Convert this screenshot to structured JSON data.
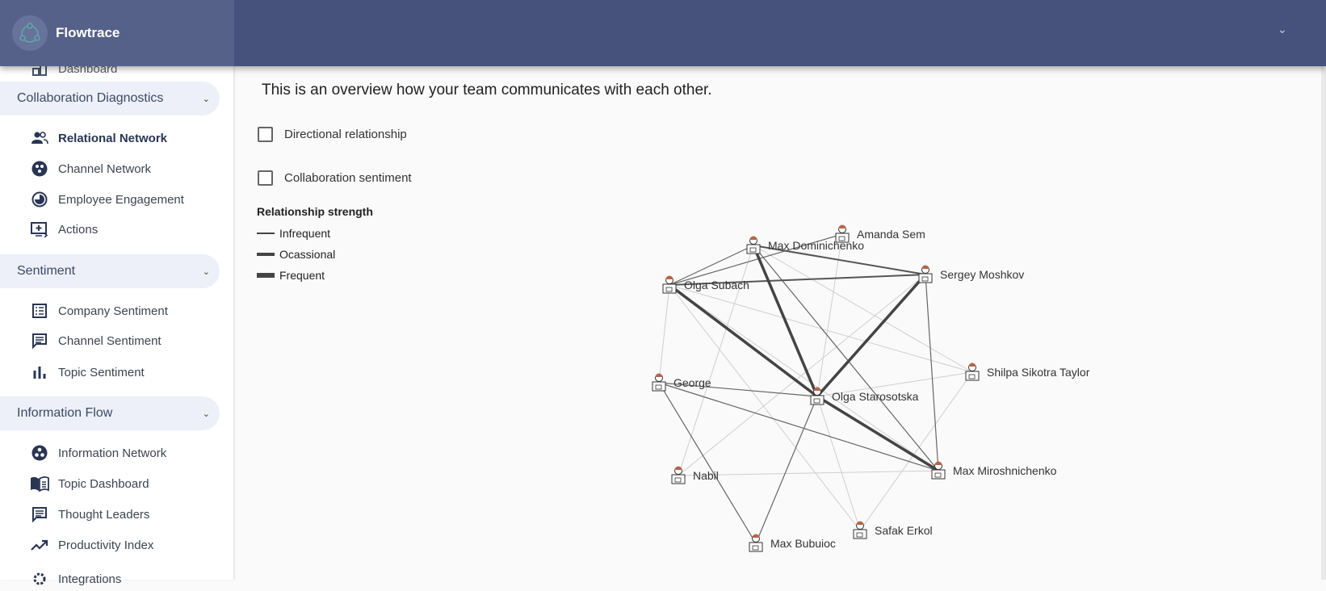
{
  "app": {
    "name": "Flowtrace"
  },
  "sidebar": {
    "partial_top": "Dashboard",
    "sections": [
      {
        "label": "Collaboration Diagnostics",
        "items": [
          {
            "label": "Relational Network",
            "icon": "people-icon",
            "active": true
          },
          {
            "label": "Channel Network",
            "icon": "channel-network-icon"
          },
          {
            "label": "Employee Engagement",
            "icon": "engagement-icon"
          },
          {
            "label": "Actions",
            "icon": "add-to-queue-icon"
          }
        ]
      },
      {
        "label": "Sentiment",
        "items": [
          {
            "label": "Company Sentiment",
            "icon": "list-icon"
          },
          {
            "label": "Channel Sentiment",
            "icon": "chat-icon"
          },
          {
            "label": "Topic Sentiment",
            "icon": "bar-chart-icon"
          }
        ]
      },
      {
        "label": "Information Flow",
        "items": [
          {
            "label": "Information Network",
            "icon": "bubble-icon"
          },
          {
            "label": "Topic Dashboard",
            "icon": "book-icon"
          },
          {
            "label": "Thought Leaders",
            "icon": "chat-icon"
          },
          {
            "label": "Productivity Index",
            "icon": "trending-up-icon"
          }
        ]
      }
    ],
    "partial_bottom": "Integrations"
  },
  "main": {
    "title": "This is an overview how your team communicates with each other.",
    "checkboxes": [
      {
        "label": "Directional relationship",
        "checked": false
      },
      {
        "label": "Collaboration sentiment",
        "checked": false
      }
    ],
    "legend": {
      "title": "Relationship strength",
      "items": [
        "Infrequent",
        "Ocassional",
        "Frequent"
      ]
    }
  },
  "colors": {
    "header": "#47527c",
    "node": "#b5654a",
    "edge": "#444444"
  },
  "network": {
    "nodes": [
      "Max Dominichenko",
      "Amanda Sem",
      "Sergey Moshkov",
      "Olga Subach",
      "Shilpa Sikotra Taylor",
      "George",
      "Olga Starosotska",
      "Max Miroshnichenko",
      "Nabil",
      "Safak Erkol",
      "Max Bubuioc"
    ],
    "edges": [
      [
        "Olga Subach",
        "Olga Starosotska",
        "Frequent"
      ],
      [
        "Max Dominichenko",
        "Olga Starosotska",
        "Frequent"
      ],
      [
        "Sergey Moshkov",
        "Olga Starosotska",
        "Frequent"
      ],
      [
        "Olga Starosotska",
        "Max Miroshnichenko",
        "Frequent"
      ],
      [
        "Max Dominichenko",
        "Sergey Moshkov",
        "Ocassional"
      ],
      [
        "Olga Subach",
        "Sergey Moshkov",
        "Ocassional"
      ],
      [
        "Olga Subach",
        "Max Dominichenko",
        "Infrequent"
      ],
      [
        "Olga Subach",
        "Amanda Sem",
        "Infrequent"
      ],
      [
        "George",
        "Olga Starosotska",
        "Infrequent"
      ],
      [
        "George",
        "Max Miroshnichenko",
        "Infrequent"
      ],
      [
        "Sergey Moshkov",
        "Max Miroshnichenko",
        "Infrequent"
      ],
      [
        "Max Dominichenko",
        "Max Miroshnichenko",
        "Infrequent"
      ],
      [
        "George",
        "Max Bubuioc",
        "Infrequent"
      ],
      [
        "Olga Starosotska",
        "Max Bubuioc",
        "Infrequent"
      ],
      [
        "Olga Subach",
        "George",
        "Faint"
      ],
      [
        "Olga Subach",
        "Shilpa Sikotra Taylor",
        "Faint"
      ],
      [
        "Olga Subach",
        "Safak Erkol",
        "Faint"
      ],
      [
        "Max Dominichenko",
        "Shilpa Sikotra Taylor",
        "Faint"
      ],
      [
        "Max Dominichenko",
        "Nabil",
        "Faint"
      ],
      [
        "Amanda Sem",
        "Olga Starosotska",
        "Faint"
      ],
      [
        "Nabil",
        "Max Miroshnichenko",
        "Faint"
      ],
      [
        "Olga Starosotska",
        "Shilpa Sikotra Taylor",
        "Faint"
      ],
      [
        "Shilpa Sikotra Taylor",
        "Safak Erkol",
        "Faint"
      ],
      [
        "Olga Starosotska",
        "Safak Erkol",
        "Faint"
      ],
      [
        "Nabil",
        "Sergey Moshkov",
        "Faint"
      ],
      [
        "Olga Subach",
        "Max Miroshnichenko",
        "Faint"
      ]
    ]
  }
}
